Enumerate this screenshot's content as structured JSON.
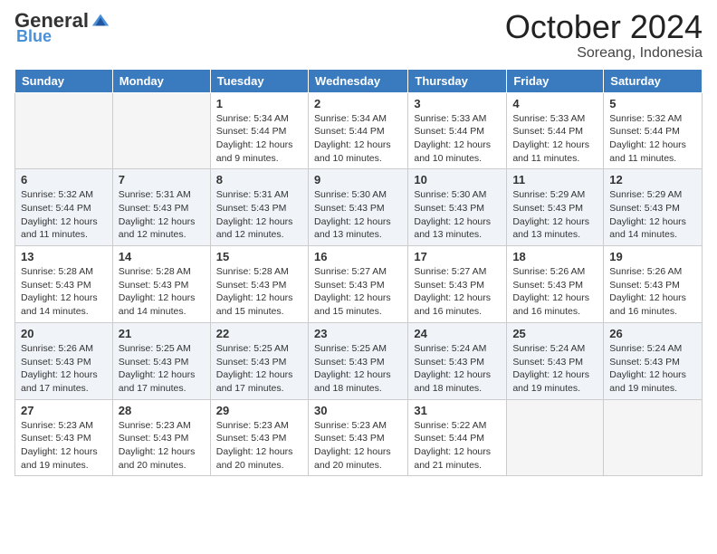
{
  "logo": {
    "general": "General",
    "blue": "Blue"
  },
  "header": {
    "month": "October 2024",
    "location": "Soreang, Indonesia"
  },
  "days_of_week": [
    "Sunday",
    "Monday",
    "Tuesday",
    "Wednesday",
    "Thursday",
    "Friday",
    "Saturday"
  ],
  "weeks": [
    [
      {
        "day": "",
        "empty": true
      },
      {
        "day": "",
        "empty": true
      },
      {
        "day": "1",
        "sunrise": "5:34 AM",
        "sunset": "5:44 PM",
        "daylight": "12 hours and 9 minutes."
      },
      {
        "day": "2",
        "sunrise": "5:34 AM",
        "sunset": "5:44 PM",
        "daylight": "12 hours and 10 minutes."
      },
      {
        "day": "3",
        "sunrise": "5:33 AM",
        "sunset": "5:44 PM",
        "daylight": "12 hours and 10 minutes."
      },
      {
        "day": "4",
        "sunrise": "5:33 AM",
        "sunset": "5:44 PM",
        "daylight": "12 hours and 11 minutes."
      },
      {
        "day": "5",
        "sunrise": "5:32 AM",
        "sunset": "5:44 PM",
        "daylight": "12 hours and 11 minutes."
      }
    ],
    [
      {
        "day": "6",
        "sunrise": "5:32 AM",
        "sunset": "5:44 PM",
        "daylight": "12 hours and 11 minutes."
      },
      {
        "day": "7",
        "sunrise": "5:31 AM",
        "sunset": "5:43 PM",
        "daylight": "12 hours and 12 minutes."
      },
      {
        "day": "8",
        "sunrise": "5:31 AM",
        "sunset": "5:43 PM",
        "daylight": "12 hours and 12 minutes."
      },
      {
        "day": "9",
        "sunrise": "5:30 AM",
        "sunset": "5:43 PM",
        "daylight": "12 hours and 13 minutes."
      },
      {
        "day": "10",
        "sunrise": "5:30 AM",
        "sunset": "5:43 PM",
        "daylight": "12 hours and 13 minutes."
      },
      {
        "day": "11",
        "sunrise": "5:29 AM",
        "sunset": "5:43 PM",
        "daylight": "12 hours and 13 minutes."
      },
      {
        "day": "12",
        "sunrise": "5:29 AM",
        "sunset": "5:43 PM",
        "daylight": "12 hours and 14 minutes."
      }
    ],
    [
      {
        "day": "13",
        "sunrise": "5:28 AM",
        "sunset": "5:43 PM",
        "daylight": "12 hours and 14 minutes."
      },
      {
        "day": "14",
        "sunrise": "5:28 AM",
        "sunset": "5:43 PM",
        "daylight": "12 hours and 14 minutes."
      },
      {
        "day": "15",
        "sunrise": "5:28 AM",
        "sunset": "5:43 PM",
        "daylight": "12 hours and 15 minutes."
      },
      {
        "day": "16",
        "sunrise": "5:27 AM",
        "sunset": "5:43 PM",
        "daylight": "12 hours and 15 minutes."
      },
      {
        "day": "17",
        "sunrise": "5:27 AM",
        "sunset": "5:43 PM",
        "daylight": "12 hours and 16 minutes."
      },
      {
        "day": "18",
        "sunrise": "5:26 AM",
        "sunset": "5:43 PM",
        "daylight": "12 hours and 16 minutes."
      },
      {
        "day": "19",
        "sunrise": "5:26 AM",
        "sunset": "5:43 PM",
        "daylight": "12 hours and 16 minutes."
      }
    ],
    [
      {
        "day": "20",
        "sunrise": "5:26 AM",
        "sunset": "5:43 PM",
        "daylight": "12 hours and 17 minutes."
      },
      {
        "day": "21",
        "sunrise": "5:25 AM",
        "sunset": "5:43 PM",
        "daylight": "12 hours and 17 minutes."
      },
      {
        "day": "22",
        "sunrise": "5:25 AM",
        "sunset": "5:43 PM",
        "daylight": "12 hours and 17 minutes."
      },
      {
        "day": "23",
        "sunrise": "5:25 AM",
        "sunset": "5:43 PM",
        "daylight": "12 hours and 18 minutes."
      },
      {
        "day": "24",
        "sunrise": "5:24 AM",
        "sunset": "5:43 PM",
        "daylight": "12 hours and 18 minutes."
      },
      {
        "day": "25",
        "sunrise": "5:24 AM",
        "sunset": "5:43 PM",
        "daylight": "12 hours and 19 minutes."
      },
      {
        "day": "26",
        "sunrise": "5:24 AM",
        "sunset": "5:43 PM",
        "daylight": "12 hours and 19 minutes."
      }
    ],
    [
      {
        "day": "27",
        "sunrise": "5:23 AM",
        "sunset": "5:43 PM",
        "daylight": "12 hours and 19 minutes."
      },
      {
        "day": "28",
        "sunrise": "5:23 AM",
        "sunset": "5:43 PM",
        "daylight": "12 hours and 20 minutes."
      },
      {
        "day": "29",
        "sunrise": "5:23 AM",
        "sunset": "5:43 PM",
        "daylight": "12 hours and 20 minutes."
      },
      {
        "day": "30",
        "sunrise": "5:23 AM",
        "sunset": "5:43 PM",
        "daylight": "12 hours and 20 minutes."
      },
      {
        "day": "31",
        "sunrise": "5:22 AM",
        "sunset": "5:44 PM",
        "daylight": "12 hours and 21 minutes."
      },
      {
        "day": "",
        "empty": true
      },
      {
        "day": "",
        "empty": true
      }
    ]
  ],
  "labels": {
    "sunrise": "Sunrise:",
    "sunset": "Sunset:",
    "daylight": "Daylight:"
  }
}
